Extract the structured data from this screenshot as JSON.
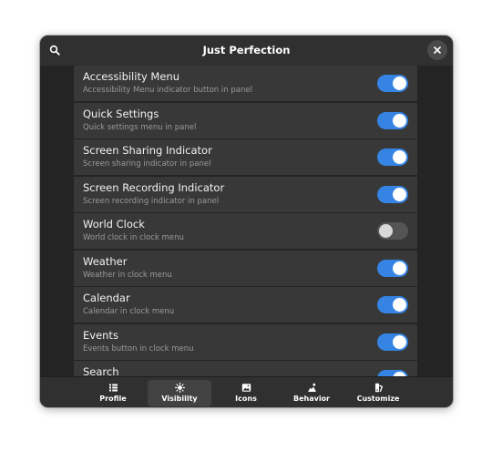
{
  "window": {
    "title": "Just Perfection"
  },
  "header": {
    "search_icon": "search-icon",
    "close_icon": "close-icon"
  },
  "rows": [
    {
      "title": "Accessibility Menu",
      "subtitle": "Accessibility Menu indicator button in panel",
      "enabled": true
    },
    {
      "title": "Quick Settings",
      "subtitle": "Quick settings menu in panel",
      "enabled": true
    },
    {
      "title": "Screen Sharing Indicator",
      "subtitle": "Screen sharing indicator in panel",
      "enabled": true
    },
    {
      "title": "Screen Recording Indicator",
      "subtitle": "Screen recording indicator in panel",
      "enabled": true
    },
    {
      "title": "World Clock",
      "subtitle": "World clock in clock menu",
      "enabled": false
    },
    {
      "title": "Weather",
      "subtitle": "Weather in clock menu",
      "enabled": true
    },
    {
      "title": "Calendar",
      "subtitle": "Calendar in clock menu",
      "enabled": true
    },
    {
      "title": "Events",
      "subtitle": "Events button in clock menu",
      "enabled": true
    },
    {
      "title": "Search",
      "subtitle": "",
      "enabled": true
    }
  ],
  "tabs": [
    {
      "label": "Profile",
      "icon": "profile-icon",
      "active": false
    },
    {
      "label": "Visibility",
      "icon": "visibility-icon",
      "active": true
    },
    {
      "label": "Icons",
      "icon": "image-icon",
      "active": false
    },
    {
      "label": "Behavior",
      "icon": "behavior-icon",
      "active": false
    },
    {
      "label": "Customize",
      "icon": "customize-icon",
      "active": false
    }
  ],
  "colors": {
    "accent": "#3584e4",
    "window_bg": "#2b2b2b",
    "row_bg": "#383838"
  }
}
